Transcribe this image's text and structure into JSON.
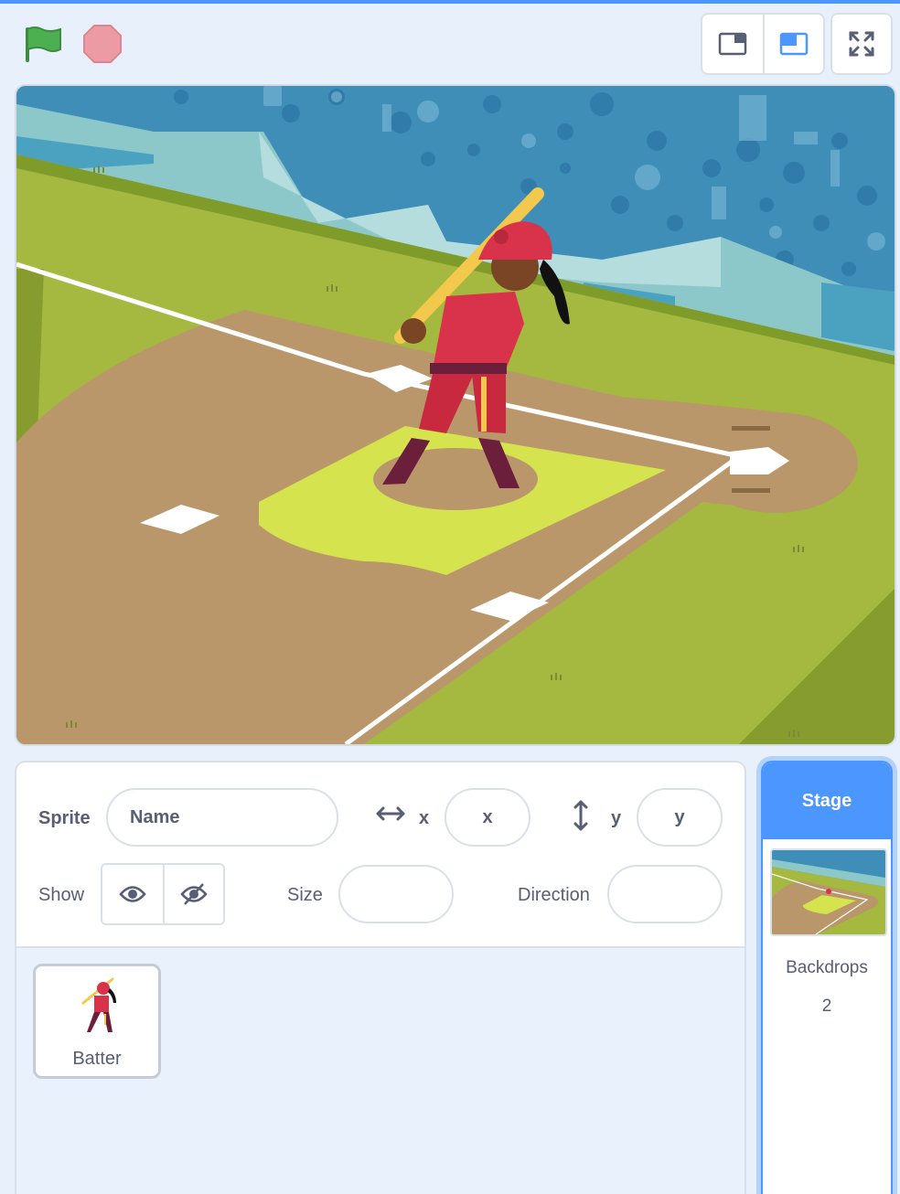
{
  "header": {
    "green_flag": "green-flag-icon",
    "stop": "stop-icon",
    "layout_modes": [
      "small-stage-icon",
      "normal-stage-icon"
    ],
    "fullscreen": "fullscreen-icon"
  },
  "colors": {
    "accent": "#4c97ff",
    "flag": "#4caf50",
    "stop": "#ec9aa4",
    "text": "#575e75"
  },
  "stage": {
    "scene": "baseball-field backdrop with batter sprite"
  },
  "sprite_info": {
    "sprite_label": "Sprite",
    "name_placeholder": "Name",
    "x_label": "x",
    "x_placeholder": "x",
    "y_label": "y",
    "y_placeholder": "y",
    "show_label": "Show",
    "size_label": "Size",
    "direction_label": "Direction"
  },
  "sprites": [
    {
      "name": "Batter"
    }
  ],
  "stage_panel": {
    "title": "Stage",
    "backdrops_label": "Backdrops",
    "backdrops_count": "2"
  }
}
